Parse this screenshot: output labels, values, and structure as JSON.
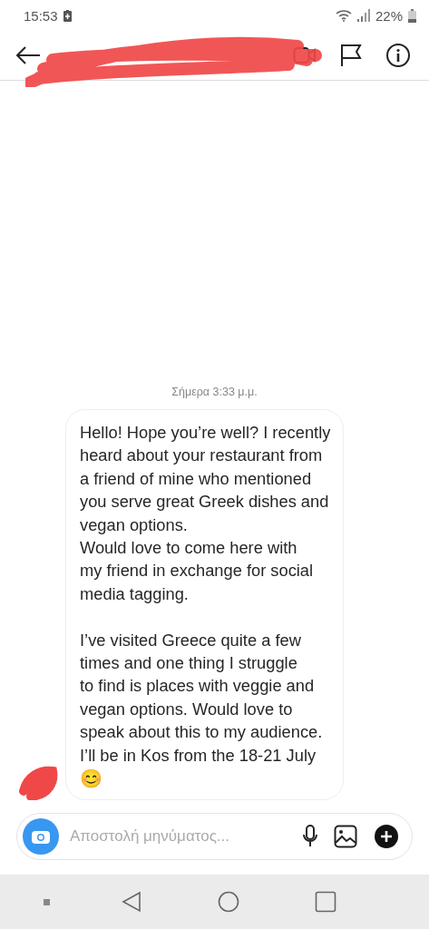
{
  "status_bar": {
    "time": "15:53",
    "battery": "22%"
  },
  "header": {
    "redacted": true
  },
  "chat": {
    "timestamp": "Σήμερα 3:33 μ.μ.",
    "messages": [
      {
        "sender_redacted": true,
        "text": "Hello! Hope you’re well? I recently\nheard about your restaurant from\na friend of mine who mentioned\nyou serve great Greek dishes and\nvegan options.\nWould love to come here with\nmy friend in exchange for social\nmedia tagging.\n\nI’ve visited Greece quite a few\ntimes and one thing I struggle\nto find is places with veggie and\nvegan options. Would love to\nspeak about this to my audience.\nI’ll be in Kos from the 18-21 July",
        "emoji": "😊"
      }
    ]
  },
  "composer": {
    "placeholder": "Αποστολή μηνύματος..."
  }
}
